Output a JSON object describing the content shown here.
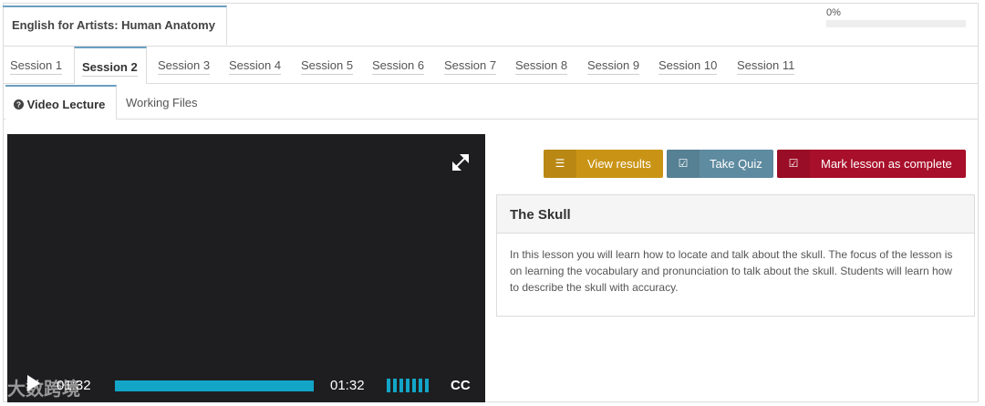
{
  "course": {
    "title": "English for Artists: Human Anatomy"
  },
  "progress": {
    "label": "0%",
    "value": 0
  },
  "sessions": [
    {
      "label": "Session 1"
    },
    {
      "label": "Session 2"
    },
    {
      "label": "Session 3"
    },
    {
      "label": "Session 4"
    },
    {
      "label": "Session 5"
    },
    {
      "label": "Session 6"
    },
    {
      "label": "Session 7"
    },
    {
      "label": "Session 8"
    },
    {
      "label": "Session 9"
    },
    {
      "label": "Session 10"
    },
    {
      "label": "Session 11"
    }
  ],
  "active_session": "Session 2",
  "subtabs": {
    "video": "Video Lecture",
    "files": "Working Files"
  },
  "player": {
    "current_time": "01:32",
    "duration": "01:32",
    "cc": "CC"
  },
  "actions": {
    "view_results": "View results",
    "take_quiz": "Take Quiz",
    "mark_complete": "Mark lesson as complete"
  },
  "lesson": {
    "title": "The Skull",
    "description": "In this lesson you will learn how to locate and talk about the skull. The focus of the lesson is on learning the vocabulary and pronunciation to talk about the skull. Students will learn how to describe the skull with accuracy."
  },
  "watermark": "大数跨境",
  "colors": {
    "accent": "#6a9fc1",
    "results": "#c99416",
    "quiz": "#5e8ba0",
    "complete": "#a80f2a",
    "player_progress": "#12a5c8"
  }
}
